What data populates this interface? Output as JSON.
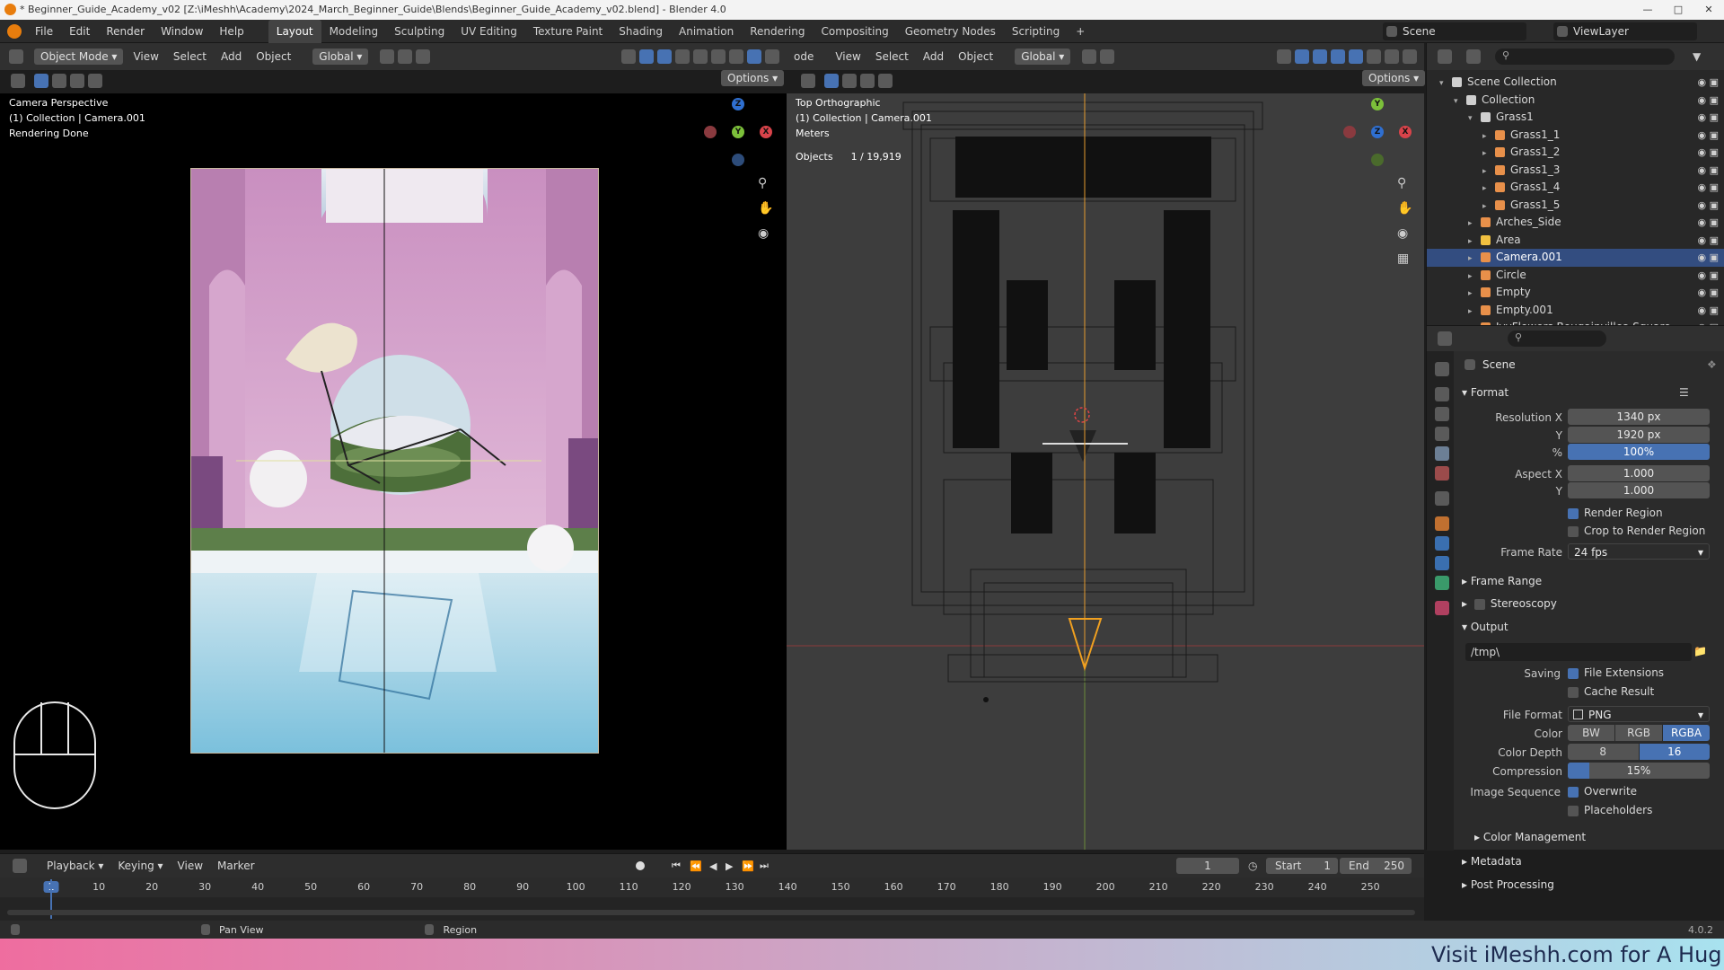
{
  "window": {
    "title": "* Beginner_Guide_Academy_v02 [Z:\\iMeshh\\Academy\\2024_March_Beginner_Guide\\Blends\\Beginner_Guide_Academy_v02.blend] - Blender 4.0"
  },
  "menu": {
    "items": [
      "File",
      "Edit",
      "Render",
      "Window",
      "Help"
    ],
    "workspaces": [
      "Layout",
      "Modeling",
      "Sculpting",
      "UV Editing",
      "Texture Paint",
      "Shading",
      "Animation",
      "Rendering",
      "Compositing",
      "Geometry Nodes",
      "Scripting"
    ],
    "active_workspace": "Layout",
    "add_tab": "+",
    "scene": "Scene",
    "view_layer": "ViewLayer"
  },
  "left_viewport": {
    "mode": "Object Mode",
    "menu": [
      "View",
      "Select",
      "Add",
      "Object"
    ],
    "orientation": "Global",
    "options": "Options",
    "overlay_lines": [
      "Camera Perspective",
      "(1) Collection | Camera.001",
      "Rendering Done"
    ]
  },
  "right_viewport": {
    "mode_fragment": "ode",
    "menu": [
      "View",
      "Select",
      "Add",
      "Object"
    ],
    "orientation": "Global",
    "options": "Options",
    "overlay_lines": [
      "Top Orthographic",
      "(1) Collection | Camera.001",
      "Meters"
    ],
    "objects_label": "Objects",
    "objects_count": "1 / 19,919"
  },
  "gizmo": {
    "x": "X",
    "y": "Y",
    "z": "Z"
  },
  "outliner": {
    "rows": [
      {
        "label": "Scene Collection",
        "indent": 0,
        "icon": "collection"
      },
      {
        "label": "Collection",
        "indent": 1,
        "icon": "collection"
      },
      {
        "label": "Grass1",
        "indent": 2,
        "icon": "collection"
      },
      {
        "label": "Grass1_1",
        "indent": 3,
        "icon": "mesh"
      },
      {
        "label": "Grass1_2",
        "indent": 3,
        "icon": "mesh"
      },
      {
        "label": "Grass1_3",
        "indent": 3,
        "icon": "mesh"
      },
      {
        "label": "Grass1_4",
        "indent": 3,
        "icon": "mesh"
      },
      {
        "label": "Grass1_5",
        "indent": 3,
        "icon": "mesh"
      },
      {
        "label": "Arches_Side",
        "indent": 2,
        "icon": "mesh"
      },
      {
        "label": "Area",
        "indent": 2,
        "icon": "light"
      },
      {
        "label": "Camera.001",
        "indent": 2,
        "icon": "camera",
        "selected": true
      },
      {
        "label": "Circle",
        "indent": 2,
        "icon": "mesh"
      },
      {
        "label": "Empty",
        "indent": 2,
        "icon": "empty"
      },
      {
        "label": "Empty.001",
        "indent": 2,
        "icon": "empty"
      },
      {
        "label": "IvyFlowers Bougainvillea Square",
        "indent": 2,
        "icon": "mesh"
      }
    ]
  },
  "properties": {
    "context": "Scene",
    "format": {
      "title": "Format",
      "resolution_x_label": "Resolution X",
      "resolution_x": "1340 px",
      "y_label": "Y",
      "resolution_y": "1920 px",
      "percent_label": "%",
      "percent": "100%",
      "aspect_x_label": "Aspect X",
      "aspect_x": "1.000",
      "aspect_y_label": "Y",
      "aspect_y": "1.000",
      "render_region": "Render Region",
      "crop_region": "Crop to Render Region",
      "frame_rate_label": "Frame Rate",
      "frame_rate": "24 fps"
    },
    "frame_range": "Frame Range",
    "stereoscopy": "Stereoscopy",
    "output": {
      "title": "Output",
      "path": "/tmp\\",
      "saving_label": "Saving",
      "file_extensions": "File Extensions",
      "cache_result": "Cache Result",
      "file_format_label": "File Format",
      "file_format": "PNG",
      "color_label": "Color",
      "color_options": [
        "BW",
        "RGB",
        "RGBA"
      ],
      "color_depth_label": "Color Depth",
      "color_depth_options": [
        "8",
        "16"
      ],
      "compression_label": "Compression",
      "compression": "15%",
      "compression_fraction": 0.15,
      "image_sequence_label": "Image Sequence",
      "overwrite": "Overwrite",
      "placeholders": "Placeholders",
      "color_management": "Color Management"
    },
    "metadata": "Metadata",
    "post_processing": "Post Processing"
  },
  "timeline": {
    "menu": [
      "Playback",
      "Keying",
      "View",
      "Marker"
    ],
    "current_frame": "1",
    "start_label": "Start",
    "start": "1",
    "end_label": "End",
    "end": "250",
    "ticks": [
      "1",
      "10",
      "20",
      "30",
      "40",
      "50",
      "60",
      "70",
      "80",
      "90",
      "100",
      "110",
      "120",
      "130",
      "140",
      "150",
      "160",
      "170",
      "180",
      "190",
      "200",
      "210",
      "220",
      "230",
      "240",
      "250"
    ]
  },
  "statusbar": {
    "pan_view": "Pan View",
    "region": "Region",
    "version": "4.0.2"
  },
  "banner": {
    "text": "Visit iMeshh.com for A Hug"
  }
}
